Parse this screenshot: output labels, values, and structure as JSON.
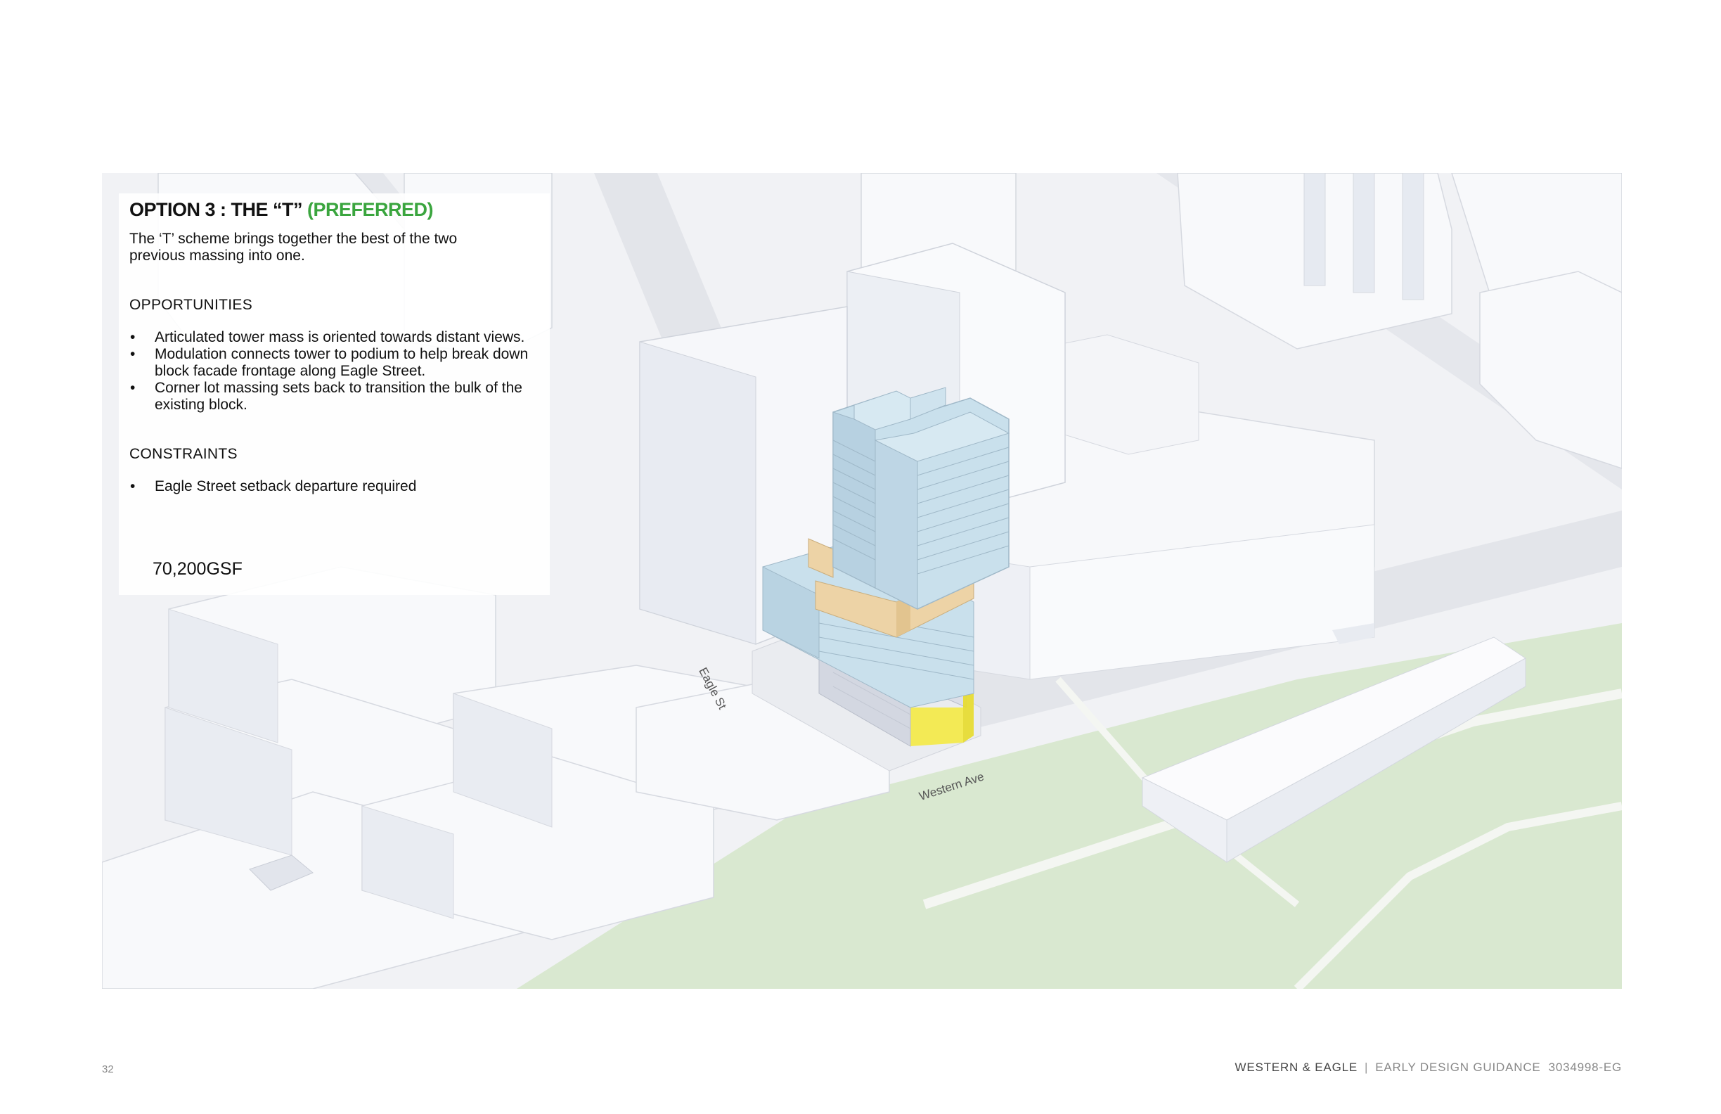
{
  "panel": {
    "title_main": "OPTION 3 : THE “T” ",
    "title_pref": "(PREFERRED)",
    "intro": "The ‘T’ scheme brings together the best of the two previous massing into one.",
    "opportunities_heading": "OPPORTUNITIES",
    "opportunities": [
      "Articulated tower mass is oriented towards distant views.",
      "Modulation connects tower to podium to help break down block facade frontage along Eagle Street.",
      "Corner lot massing sets back to transition the bulk of the existing block."
    ],
    "constraints_heading": "CONSTRAINTS",
    "constraints": [
      "Eagle Street setback departure required"
    ],
    "area": "70,200GSF"
  },
  "map": {
    "street_eagle": "Eagle St",
    "street_western": "Western Ave"
  },
  "footer": {
    "page_number": "32",
    "project": "WESTERN & EAGLE",
    "document": "EARLY DESIGN GUIDANCE",
    "code": "3034998-EG"
  },
  "colors": {
    "preferred_green": "#3aa53e",
    "tower_blue": "#c9e0ec",
    "amenity_tan": "#edd3a6",
    "entry_yellow": "#f4ea3a",
    "park_green": "#d9e8d0"
  }
}
